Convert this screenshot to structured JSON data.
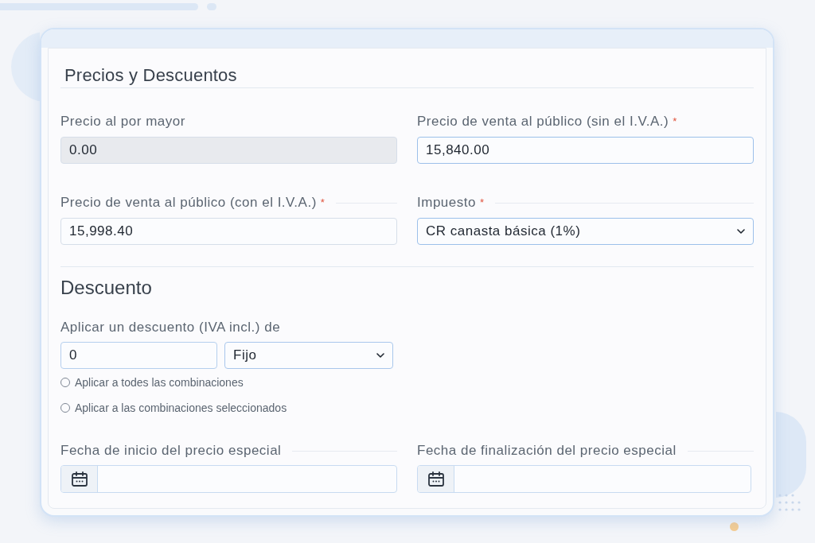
{
  "section": {
    "title": "Precios y Descuentos"
  },
  "price_fields": [
    {
      "kind": "input",
      "label": "Precio al por mayor",
      "value": "0.00",
      "disabled": true,
      "highlighted": false
    },
    {
      "kind": "input",
      "label": "Precio de venta al público (sin el I.V.A.)",
      "required_mark": "*",
      "value": "15,840.00",
      "disabled": false,
      "highlighted": true
    },
    {
      "kind": "input",
      "label": "Precio de venta al público (con el I.V.A.)",
      "required_mark": "*",
      "value": "15,998.40",
      "disabled": false,
      "highlighted": false
    },
    {
      "kind": "select",
      "label": "Impuesto",
      "required_mark": "*",
      "value": "CR canasta básica (1%)",
      "disabled": false,
      "highlighted": true
    }
  ],
  "discount": {
    "title": "Descuento",
    "label": "Aplicar un descuento (IVA incl.) de",
    "amount": "0",
    "type": "Fijo",
    "options": [
      {
        "label": "Aplicar a todes las combinaciones",
        "selected": false
      },
      {
        "label": "Aplicar a las combinaciones seleccionados",
        "selected": false
      }
    ]
  },
  "date_fields": [
    {
      "label": "Fecha de inicio del precio especial"
    },
    {
      "label": "Fecha de finalización del precio especial"
    }
  ]
}
